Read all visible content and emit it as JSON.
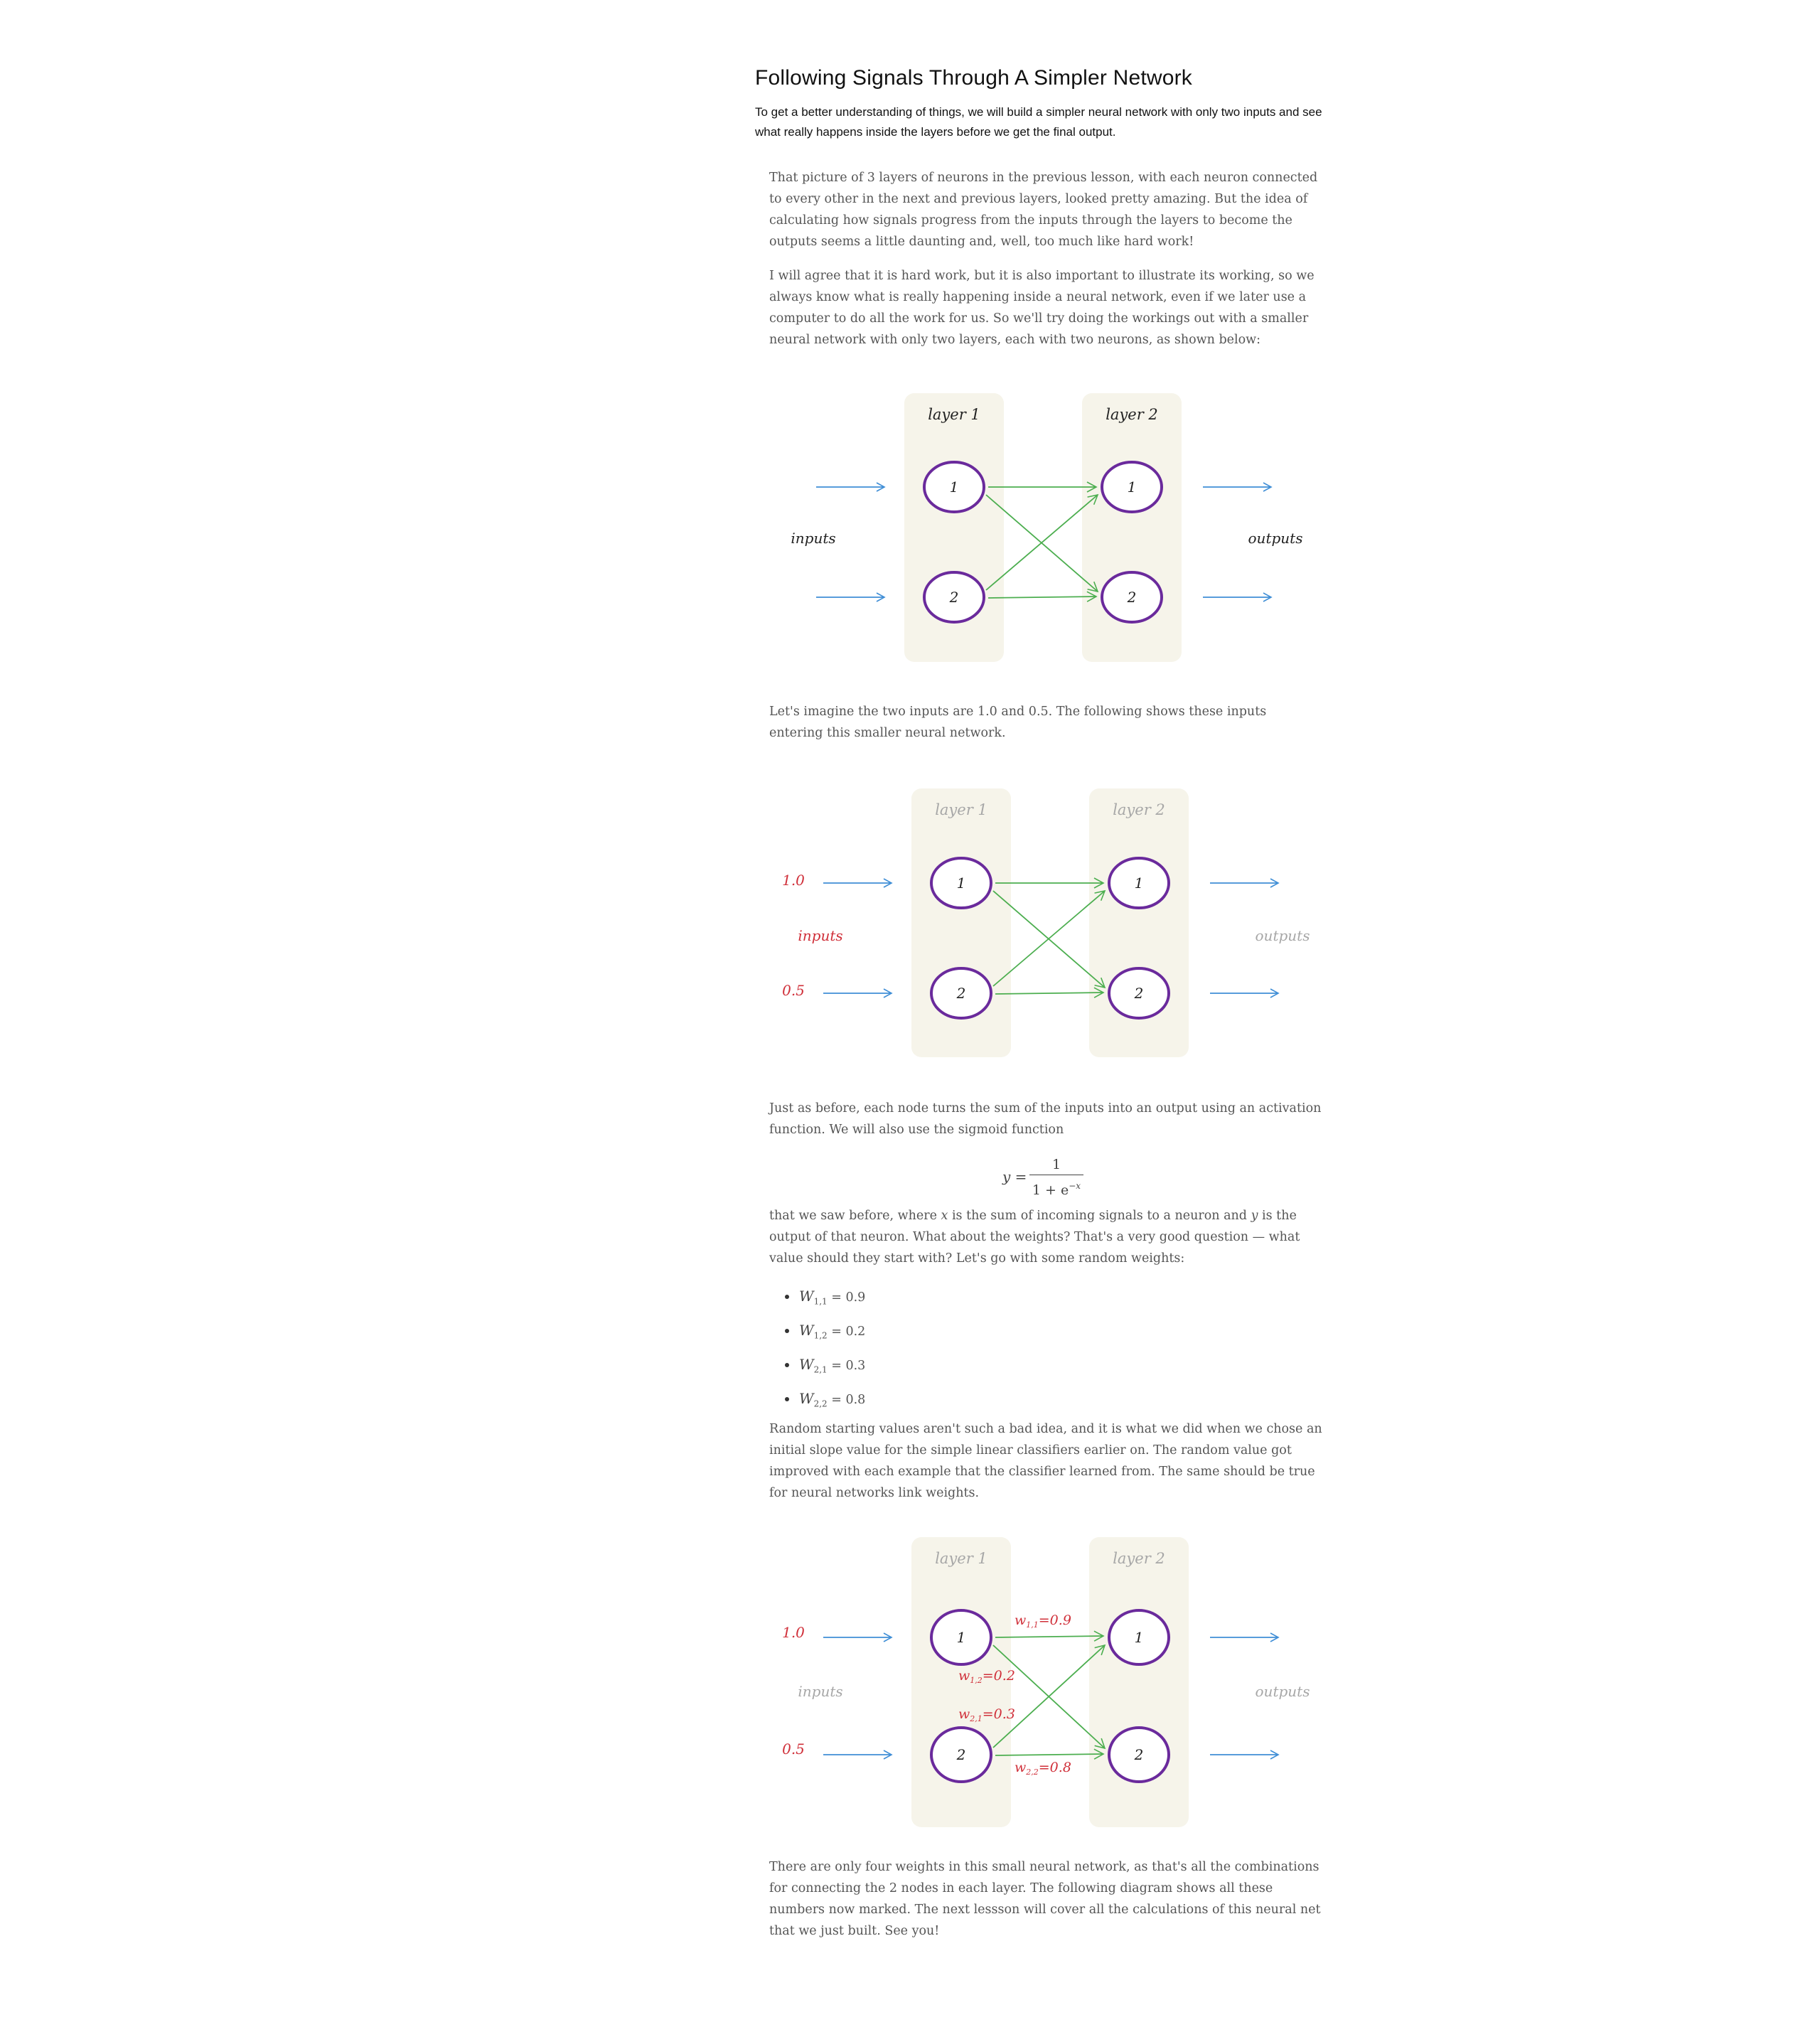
{
  "header": {
    "title": "Following Signals Through A Simpler Network",
    "subtitle": "To get a better understanding of things, we will build a simpler neural network with only two inputs and see what really happens inside the layers before we get the final output."
  },
  "paragraphs": {
    "p1": "That picture of 3 layers of neurons in the previous lesson, with each neuron connected to every other in the next and previous layers, looked pretty amazing. But the idea of calculating how signals progress from the inputs through the layers to become the outputs seems a little daunting and, well, too much like hard work!",
    "p2": "I will agree that it is hard work, but it is also important to illustrate its working, so we always know what is really happening inside a neural network, even if we later use a computer to do all the work for us. So we'll try doing the workings out with a smaller neural network with only two layers, each with two neurons, as shown below:",
    "p3": "Let's imagine the two inputs are 1.0 and 0.5. The following shows these inputs entering this smaller neural network.",
    "p4": "Just as before, each node turns the sum of the inputs into an output using an activation function. We will also use the sigmoid function",
    "p5_a": "that we saw before, where ",
    "p5_x": "x",
    "p5_b": " is the sum of incoming signals to a neuron and ",
    "p5_y": "y",
    "p5_c": " is the output of that neuron. What about the weights? That's a very good question — what value should they start with? Let's go with some random weights:",
    "p6": "Random starting values aren't such a bad idea, and it is what we did when we chose an initial slope value for the simple linear classifiers earlier on. The random value got improved with each example that the classifier learned from. The same should be true for neural networks link weights.",
    "p7": "There are only four weights in this small neural network, as that's all the combinations for connecting the 2 nodes in each layer.  The following diagram shows all these numbers now marked. The next lessson will cover all the calculations of this neural net that we just built. See you!"
  },
  "equation": {
    "lhs": "y =",
    "numerator": "1",
    "denominator": "1 + e",
    "exponent": "−x"
  },
  "weights": [
    {
      "symbol": "W",
      "sub": "1,1",
      "value": " = 0.9"
    },
    {
      "symbol": "W",
      "sub": "1,2",
      "value": " = 0.2"
    },
    {
      "symbol": "W",
      "sub": "2,1",
      "value": " = 0.3"
    },
    {
      "symbol": "W",
      "sub": "2,2",
      "value": " = 0.8"
    }
  ],
  "diagram": {
    "layer1": "layer 1",
    "layer2": "layer 2",
    "node1": "1",
    "node2": "2",
    "inputs": "inputs",
    "outputs": "outputs",
    "input_value_1": "1.0",
    "input_value_2": "0.5",
    "w11": "w",
    "w11_sub": "1,1",
    "w11_val": "=0.9",
    "w12": "w",
    "w12_sub": "1,2",
    "w12_val": "=0.2",
    "w21": "w",
    "w21_sub": "2,1",
    "w21_val": "=0.3",
    "w22": "w",
    "w22_sub": "2,2",
    "w22_val": "=0.8"
  },
  "colors": {
    "layer_bg": "#f6f4ea",
    "node_stroke": "#6a2a9c",
    "link": "#4cae4f",
    "arrow": "#3f8ed6",
    "highlight": "#d0303a",
    "muted": "#a7a7a7"
  }
}
